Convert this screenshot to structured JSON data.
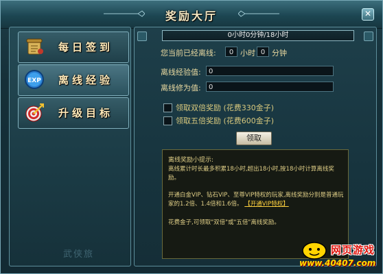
{
  "window": {
    "title": "奖励大厅"
  },
  "nav": [
    {
      "label": "每日签到",
      "icon": "scroll-icon"
    },
    {
      "label": "离线经验",
      "icon": "exp-icon"
    },
    {
      "label": "升级目标",
      "icon": "target-icon"
    }
  ],
  "watermark": "武侠旅",
  "offline": {
    "progress_text": "0小时0分钟/18小时",
    "progress": 0,
    "offline_label": "您当前已经离线:",
    "hours_value": "0",
    "hours_unit": "小时",
    "minutes_value": "0",
    "minutes_unit": "分钟",
    "exp_label": "离线经验值:",
    "exp_value": "0",
    "cultivation_label": "离线修为值:",
    "cultivation_value": "0",
    "double_reward_label": "领取双倍奖励 (花费330金子)",
    "five_reward_label": "领取五倍奖励 (花费600金子)",
    "receive_button": "领取"
  },
  "tips": {
    "title": "离线奖励小提示:",
    "p1": "离线累计时长最多积累18小时,超出18小时,按18小时计算离线奖励。",
    "p2": "开通白金VIP、钻石VIP、至尊VIP特权的玩家,离线奖励分别是普通玩家的1.2倍、1.4倍和1.6倍。",
    "vip_link": "【开通VIP特权】",
    "p3": "花费金子,可领取\"双倍\"或\"五倍\"离线奖励。"
  },
  "logo": {
    "text": "网页游戏",
    "url": "www.40407.com"
  },
  "colors": {
    "accent": "#ffe9b8",
    "panel": "#1b3b45",
    "tip_text": "#e0cf87",
    "link": "#ffd23f"
  }
}
